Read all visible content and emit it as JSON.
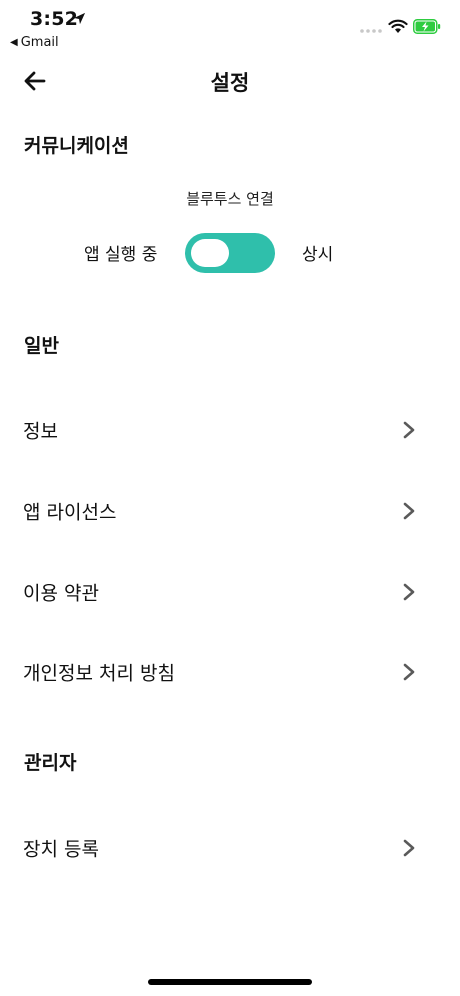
{
  "status_bar": {
    "time": "3:52",
    "back_app": "Gmail",
    "back_arrow": "◀",
    "battery_color": "#2ecc40"
  },
  "nav": {
    "title": "설정",
    "back_icon": "back-arrow-icon"
  },
  "communication": {
    "header": "커뮤니케이션",
    "bluetooth_label": "블루투스 연결",
    "option_left": "앱 실행 중",
    "option_right": "상시",
    "toggle_state": "on",
    "accent_color": "#2fbfab"
  },
  "general": {
    "header": "일반",
    "items": [
      {
        "label": "정보"
      },
      {
        "label": "앱 라이선스"
      },
      {
        "label": "이용 약관"
      },
      {
        "label": "개인정보 처리 방침"
      }
    ]
  },
  "admin": {
    "header": "관리자",
    "items": [
      {
        "label": "장치 등록"
      }
    ]
  }
}
